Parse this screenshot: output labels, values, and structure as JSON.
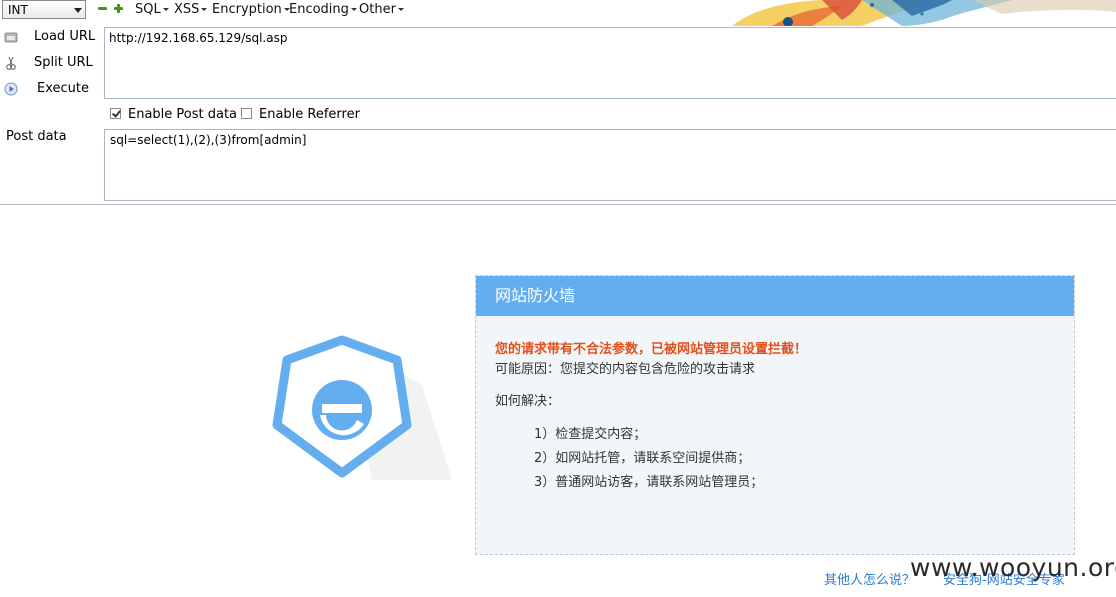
{
  "hackbar": {
    "select_value": "INT",
    "menus": [
      {
        "label": "SQL"
      },
      {
        "label": "XSS"
      },
      {
        "label": "Encryption"
      },
      {
        "label": "Encoding"
      },
      {
        "label": "Other"
      }
    ],
    "buttons": {
      "load_url": "Load URL",
      "split_url": "Split URL",
      "execute": "Execute"
    },
    "url_value": "http://192.168.65.129/sql.asp",
    "enable_post_label": "Enable Post data",
    "enable_post_checked": true,
    "enable_referrer_label": "Enable Referrer",
    "enable_referrer_checked": false,
    "post_label": "Post data",
    "post_value": "sql=select(1),(2),(3)from[admin]"
  },
  "firewall": {
    "title": "网站防火墙",
    "warning": "您的请求带有不合法参数，已被网站管理员设置拦截！",
    "reason": "可能原因：您提交的内容包含危险的攻击请求",
    "how_to": "如何解决：",
    "steps": [
      "1）检查提交内容；",
      "2）如网站托管，请联系空间提供商；",
      "3）普通网站访客，请联系网站管理员；"
    ],
    "links": {
      "others_say": "其他人怎么说？",
      "brand": "安全狗-网站安全专家"
    },
    "colors": {
      "header": "#64aef0",
      "warning": "#e2501b",
      "link": "#2a7bd4"
    }
  },
  "watermark": "www.wooyun.org"
}
